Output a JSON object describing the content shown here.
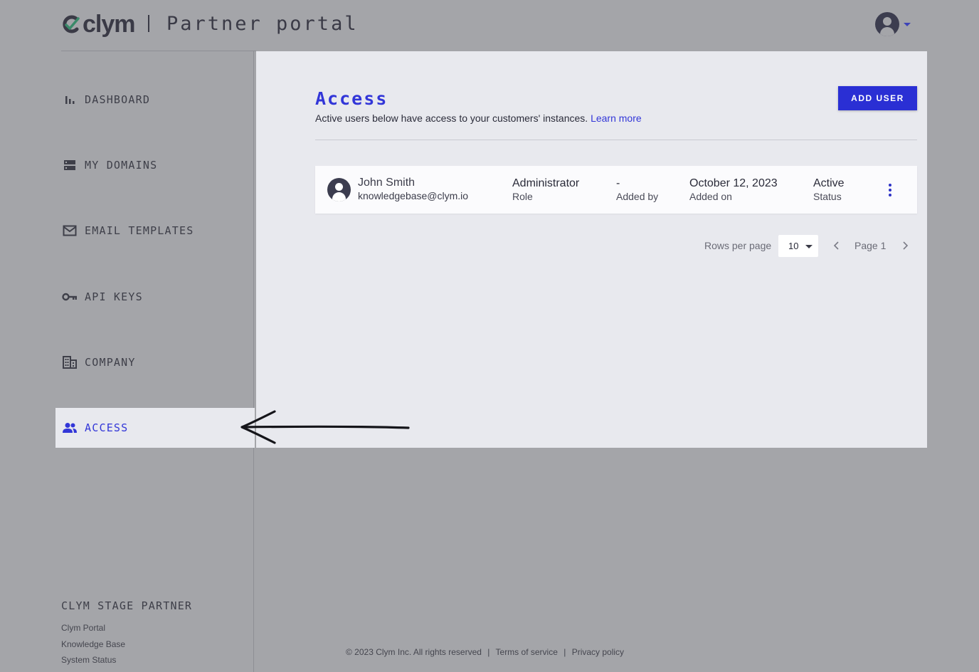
{
  "header": {
    "logo_text": "clym",
    "portal_title": "Partner portal"
  },
  "sidebar": {
    "items": [
      {
        "label": "DASHBOARD",
        "icon": "bar-chart-icon"
      },
      {
        "label": "MY DOMAINS",
        "icon": "server-icon"
      },
      {
        "label": "EMAIL TEMPLATES",
        "icon": "mail-icon"
      },
      {
        "label": "API KEYS",
        "icon": "key-icon"
      },
      {
        "label": "COMPANY",
        "icon": "building-icon"
      },
      {
        "label": "ACCESS",
        "icon": "people-icon",
        "active": true
      }
    ],
    "org_name": "CLYM STAGE PARTNER",
    "links": [
      "Clym Portal",
      "Knowledge Base",
      "System Status"
    ]
  },
  "main": {
    "title": "Access",
    "subtitle": "Active users below have access to your customers' instances.",
    "learn_more": "Learn more",
    "add_user_label": "ADD USER",
    "users": [
      {
        "name": "John Smith",
        "email": "knowledgebase@clym.io",
        "role": "Administrator",
        "role_label": "Role",
        "added_by": "-",
        "added_by_label": "Added by",
        "added_on": "October 12, 2023",
        "added_on_label": "Added on",
        "status": "Active",
        "status_label": "Status"
      }
    ],
    "pagination": {
      "rows_per_page_label": "Rows per page",
      "rows_per_page": "10",
      "page_label": "Page 1"
    }
  },
  "footer": {
    "copyright": "© 2023 Clym Inc. All rights reserved",
    "terms": "Terms of service",
    "privacy": "Privacy policy",
    "separator": "|"
  },
  "colors": {
    "accent": "#2a2fd4",
    "backdrop": "#a4a5a9",
    "panel": "#e8e9ee"
  }
}
